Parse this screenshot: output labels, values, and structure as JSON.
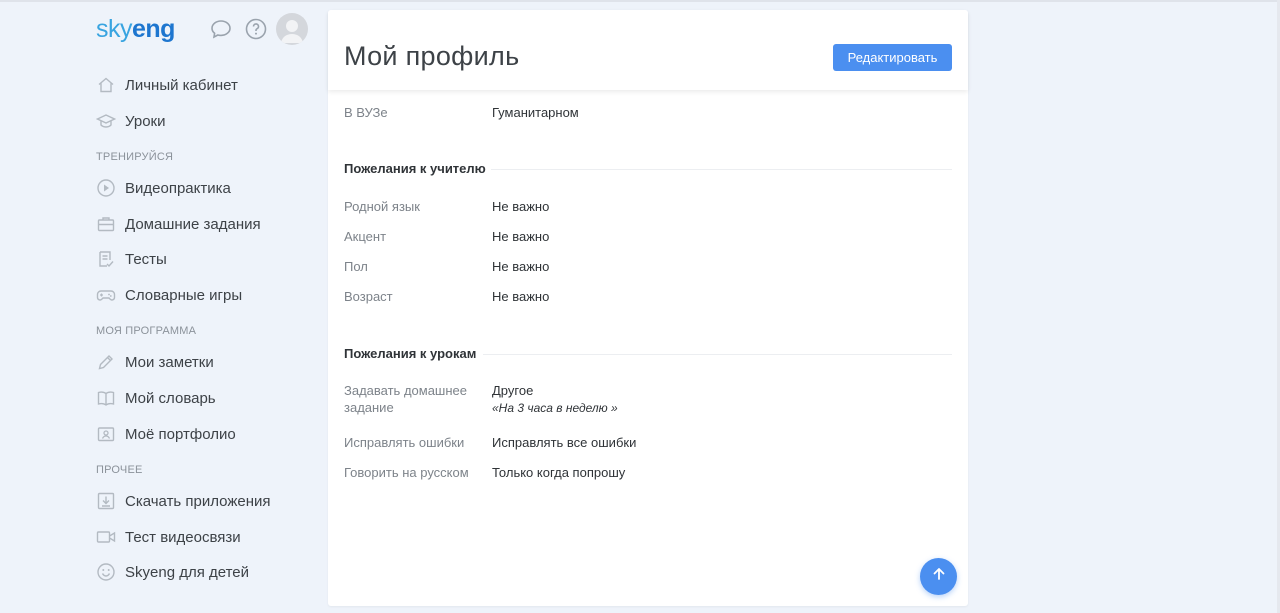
{
  "logo": {
    "part1": "sky",
    "part2": "eng"
  },
  "header_icons": [
    "chat-icon",
    "help-icon",
    "avatar"
  ],
  "sidebar": {
    "items_main": [
      {
        "label": "Личный кабинет",
        "icon": "home-icon"
      },
      {
        "label": "Уроки",
        "icon": "graduation-cap-icon"
      }
    ],
    "section1": "ТРЕНИРУЙСЯ",
    "items_train": [
      {
        "label": "Видеопрактика",
        "icon": "play-icon"
      },
      {
        "label": "Домашние задания",
        "icon": "briefcase-icon"
      },
      {
        "label": "Тесты",
        "icon": "test-icon"
      },
      {
        "label": "Словарные игры",
        "icon": "gamepad-icon"
      }
    ],
    "section2": "МОЯ ПРОГРАММА",
    "items_program": [
      {
        "label": "Мои заметки",
        "icon": "pencil-icon"
      },
      {
        "label": "Мой словарь",
        "icon": "book-icon"
      },
      {
        "label": "Моё портфолио",
        "icon": "portfolio-icon"
      }
    ],
    "section3": "ПРОЧЕЕ",
    "items_other": [
      {
        "label": "Скачать приложения",
        "icon": "download-icon"
      },
      {
        "label": "Тест видеосвязи",
        "icon": "video-icon"
      },
      {
        "label": "Skyeng для детей",
        "icon": "smile-icon"
      }
    ]
  },
  "main": {
    "title": "Мой профиль",
    "edit_button": "Редактировать",
    "top_row": {
      "label": "В ВУЗе",
      "value": "Гуманитарном"
    },
    "teacher_section": {
      "title": "Пожелания к учителю",
      "rows": [
        {
          "label": "Родной язык",
          "value": "Не важно"
        },
        {
          "label": "Акцент",
          "value": "Не важно"
        },
        {
          "label": "Пол",
          "value": "Не важно"
        },
        {
          "label": "Возраст",
          "value": "Не важно"
        }
      ]
    },
    "lessons_section": {
      "title": "Пожелания к урокам",
      "homework": {
        "label_line1": "Задавать домашнее",
        "label_line2": "задание",
        "value": "Другое",
        "note": "«На 3 часа в неделю »"
      },
      "rows": [
        {
          "label": "Исправлять ошибки",
          "value": "Исправлять все ошибки"
        },
        {
          "label": "Говорить на русском",
          "value": "Только когда попрошу"
        }
      ]
    }
  },
  "colors": {
    "accent": "#4b8ff0",
    "brand_light": "#39a4e0",
    "brand_dark": "#1e76cf",
    "background": "#eef3fa"
  }
}
